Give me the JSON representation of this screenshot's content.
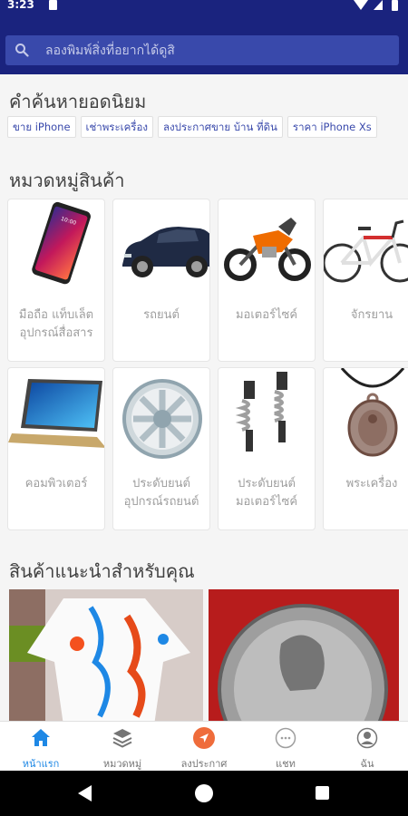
{
  "status_bar": {
    "time": "3:23"
  },
  "search": {
    "placeholder": "ลองพิมพ์สิ่งที่อยากได้ดูสิ"
  },
  "popular": {
    "title": "คำค้นหายอดนิยม",
    "chips": [
      "ขาย iPhone",
      "เช่าพระเครื่อง",
      "ลงประกาศขาย บ้าน ที่ดิน",
      "ราคา iPhone Xs"
    ]
  },
  "categories": {
    "title": "หมวดหมู่สินค้า",
    "items": [
      {
        "line1": "มือถือ แท็บเล็ต",
        "line2": "อุปกรณ์สื่อสาร",
        "image": "smartphone"
      },
      {
        "line1": "รถยนต์",
        "line2": "",
        "image": "car"
      },
      {
        "line1": "มอเตอร์ไซค์",
        "line2": "",
        "image": "motorcycle"
      },
      {
        "line1": "จักรยาน",
        "line2": "",
        "image": "bicycle"
      },
      {
        "line1": "คอมพิวเตอร์",
        "line2": "",
        "image": "laptop"
      },
      {
        "line1": "ประดับยนต์",
        "line2": "อุปกรณ์รถยนต์",
        "image": "wheel-rim"
      },
      {
        "line1": "ประดับยนต์",
        "line2": "มอเตอร์ไซค์",
        "image": "shock-absorbers"
      },
      {
        "line1": "พระเครื่อง",
        "line2": "",
        "image": "amulet"
      }
    ]
  },
  "recommended": {
    "title": "สินค้าแนะนำสำหรับคุณ",
    "items": [
      {
        "image": "embroidered-dress"
      },
      {
        "image": "silver-coin-amulet"
      }
    ]
  },
  "bottom_nav": [
    {
      "label": "หน้าแรก",
      "icon": "home-icon",
      "active": true
    },
    {
      "label": "หมวดหมู่",
      "icon": "layers-icon",
      "active": false
    },
    {
      "label": "ลงประกาศ",
      "icon": "navigate-icon",
      "active": false
    },
    {
      "label": "แชท",
      "icon": "chat-icon",
      "active": false
    },
    {
      "label": "ฉัน",
      "icon": "profile-icon",
      "active": false
    }
  ],
  "colors": {
    "header": "#1a237e",
    "search_bg": "#3949ab",
    "accent_blue": "#1e88e5",
    "accent_orange": "#ef6c3b",
    "chip_text": "#3949ab"
  }
}
